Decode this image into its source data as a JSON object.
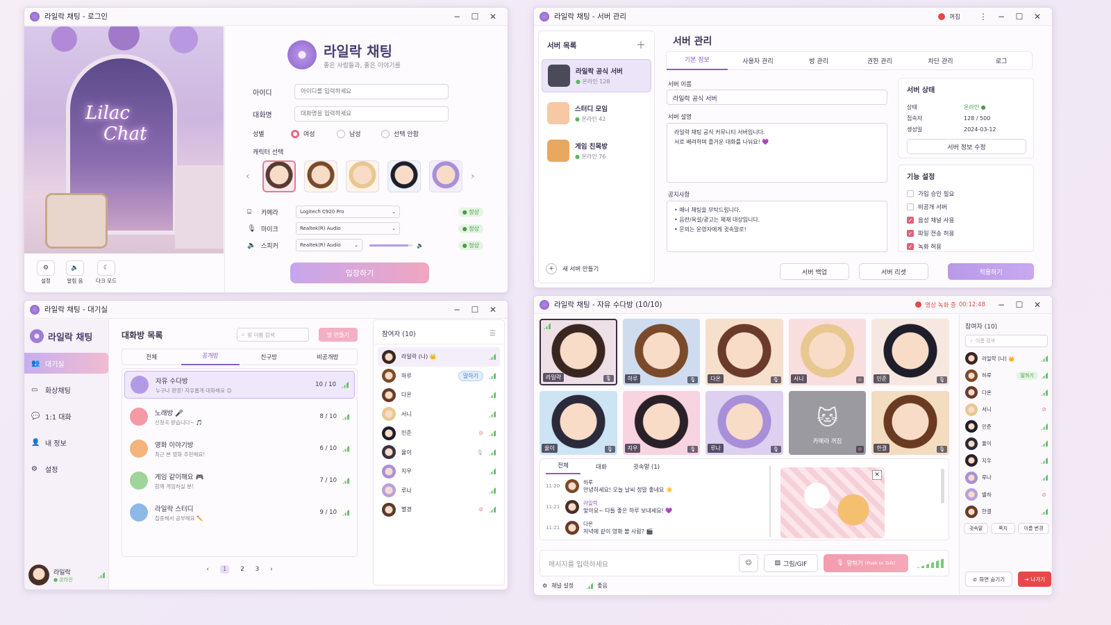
{
  "login": {
    "title": "라일락 채팅 - 로그인",
    "neon": [
      "Lilac",
      "Chat"
    ],
    "app_name": "라일락 채팅",
    "slogan": "좋은 사람들과, 좋은 이야기를",
    "id_label": "아이디",
    "id_placeholder": "아이디를 입력하세요",
    "nick_label": "대화명",
    "nick_placeholder": "대화명을 입력하세요",
    "gender_label": "성별",
    "genders": [
      "여성",
      "남성",
      "선택 안함"
    ],
    "char_label": "캐릭터 선택",
    "devices": [
      {
        "label": "카메라",
        "value": "Logitech C920 Pro",
        "status": "● 정상"
      },
      {
        "label": "마이크",
        "value": "Realtek(R) Audio",
        "status": "● 정상"
      },
      {
        "label": "스피커",
        "value": "Realtek(R) Audio",
        "status": "● 정상"
      }
    ],
    "speaker_volume": 0.9,
    "enter": "입장하기",
    "bottom": [
      "설정",
      "알림 음",
      "다크 모드"
    ]
  },
  "server": {
    "title": "라일락 채팅 - 서버 관리",
    "rec": "꺼짐",
    "list_title": "서버 목록",
    "servers": [
      {
        "name": "라일락 공식 서버",
        "online": "온라인 128"
      },
      {
        "name": "스터디 모임",
        "online": "온라인 42"
      },
      {
        "name": "게임 친목방",
        "online": "온라인 76"
      }
    ],
    "new_server": "새 서버 만들기",
    "heading": "서버 관리",
    "tabs": [
      "기본 정보",
      "사용자 관리",
      "방 관리",
      "권한 관리",
      "차단 관리",
      "로그"
    ],
    "name_label": "서버 이름",
    "name_value": "라일락 공식 서버",
    "desc_label": "서버 설명",
    "desc_lines": [
      "라일락 채팅 공식 커뮤니티 서버입니다.",
      "서로 배려하며 즐거운 대화를 나눠요! 💜"
    ],
    "notice_label": "공지사항",
    "notice_lines": [
      "• 매너 채팅을 부탁드립니다.",
      "• 음란/욕설/광고는 제재 대상입니다.",
      "• 문의는 운영자에게 귓속말로!"
    ],
    "status_title": "서버 상태",
    "status": [
      {
        "k": "상태",
        "v": "온라인 ●"
      },
      {
        "k": "접속자",
        "v": "128 / 500"
      },
      {
        "k": "생성일",
        "v": "2024-03-12"
      }
    ],
    "edit_btn": "서버 정보 수정",
    "feat_title": "기능 설정",
    "features": [
      {
        "label": "가입 승인 필요",
        "on": false
      },
      {
        "label": "비공개 서버",
        "on": false
      },
      {
        "label": "음성 채널 사용",
        "on": true
      },
      {
        "label": "파일 전송 허용",
        "on": true
      },
      {
        "label": "녹화 허용",
        "on": true
      }
    ],
    "backup": "서버 백업",
    "reset": "서버 리셋",
    "apply": "적용하기"
  },
  "lobby": {
    "title": "라일락 채팅 - 대기실",
    "brand": "라일락 채팅",
    "nav": [
      "대기실",
      "화상채팅",
      "1:1 대화",
      "내 정보",
      "설정"
    ],
    "list_title": "대화방 목록",
    "search_ph": "방 이름 검색",
    "make": "방 만들기",
    "tabs": [
      "전체",
      "공개방",
      "친구방",
      "비공개방"
    ],
    "rooms": [
      {
        "name": "자유 수다방",
        "desc": "누구나 환영! 자유롭게 대화해요 😊",
        "count": "10 / 10",
        "color": "#b39ae6"
      },
      {
        "name": "노래방 🎤",
        "desc": "신청곡 받습니다~ 🎵",
        "count": "8 / 10",
        "color": "#f39aa6"
      },
      {
        "name": "영화 이야기방",
        "desc": "최근 본 영화 추천해요!",
        "count": "6 / 10",
        "color": "#f4b47c"
      },
      {
        "name": "게임 같이해요 🎮",
        "desc": "함께 게임하실 분!",
        "count": "7 / 10",
        "color": "#9fd49a"
      },
      {
        "name": "라일락 스터디",
        "desc": "집중해서 공부해요 ✏️",
        "count": "9 / 10",
        "color": "#8db8e8"
      }
    ],
    "pages": [
      "‹",
      "1",
      "2",
      "3",
      "›"
    ],
    "me": "라일락",
    "me_status": "● 온라인",
    "part_title": "참여자 (10)",
    "participants": [
      "라일락 (나) 👑",
      "하루",
      "다온",
      "서니",
      "민준",
      "율이",
      "지우",
      "루나",
      "별경"
    ],
    "speaking": "말하기"
  },
  "video": {
    "title": "라일락 채팅 - 자유 수다방 (10/10)",
    "rec": "영상 녹화 중",
    "timer": "00:12:48",
    "tiles": [
      "라일락",
      "하루",
      "다온",
      "서니",
      "민준",
      "율이",
      "지우",
      "루나",
      "카메라 꺼짐",
      "한결"
    ],
    "chat_tabs": [
      "전체",
      "대화",
      "귓속말 (1)"
    ],
    "messages": [
      {
        "time": "11:20",
        "name": "하루",
        "text": "안녕하세요! 오늘 날씨 정말 좋네요 ☀️"
      },
      {
        "time": "11:21",
        "name": "라일락",
        "text": "맞아요~ 다들 좋은 하루 보내세요! 💜"
      },
      {
        "time": "11:21",
        "name": "다온",
        "text": "저녁에 같이 영화 볼 사람? 🎬"
      }
    ],
    "input_ph": "메시지를 입력하세요",
    "gif": "그림/GIF",
    "ptt": "말하기",
    "ptt_sub": "(Push to Talk)",
    "channel": "채널 설정",
    "quality": "좋음",
    "part_title": "참여자 (10)",
    "search_ph": "이름 검색",
    "participants": [
      "라일락 (나) 👑",
      "하루",
      "다온",
      "서니",
      "민준",
      "율이",
      "지우",
      "루나",
      "별하",
      "한결"
    ],
    "speaking": "말하기",
    "actions": [
      "귓속말",
      "쪽지",
      "이름 변경"
    ],
    "share": "화면 숨기기",
    "leave": "나가기"
  }
}
